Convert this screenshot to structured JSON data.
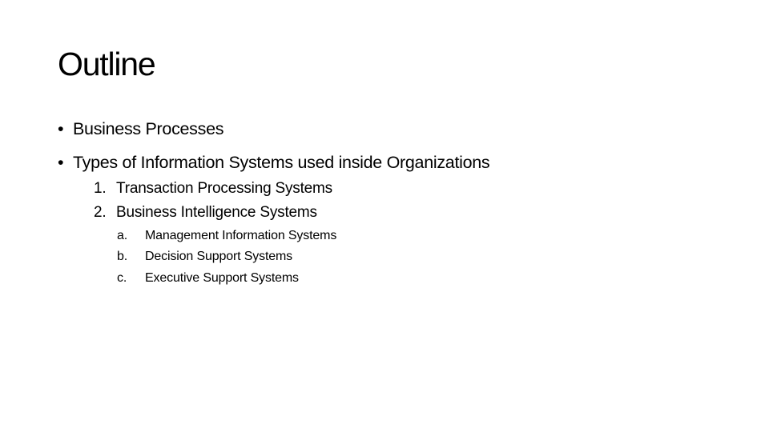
{
  "slide": {
    "title": "Outline",
    "bullets": [
      {
        "marker": "•",
        "text": "Business Processes"
      },
      {
        "marker": "•",
        "text": "Types of Information Systems used inside Organizations"
      }
    ],
    "numbered": [
      {
        "marker": "1.",
        "text": "Transaction Processing Systems"
      },
      {
        "marker": "2.",
        "text": "Business Intelligence Systems"
      }
    ],
    "lettered": [
      {
        "marker": "a.",
        "text": "Management Information Systems"
      },
      {
        "marker": "b.",
        "text": "Decision Support Systems"
      },
      {
        "marker": "c.",
        "text": "Executive Support Systems"
      }
    ]
  }
}
